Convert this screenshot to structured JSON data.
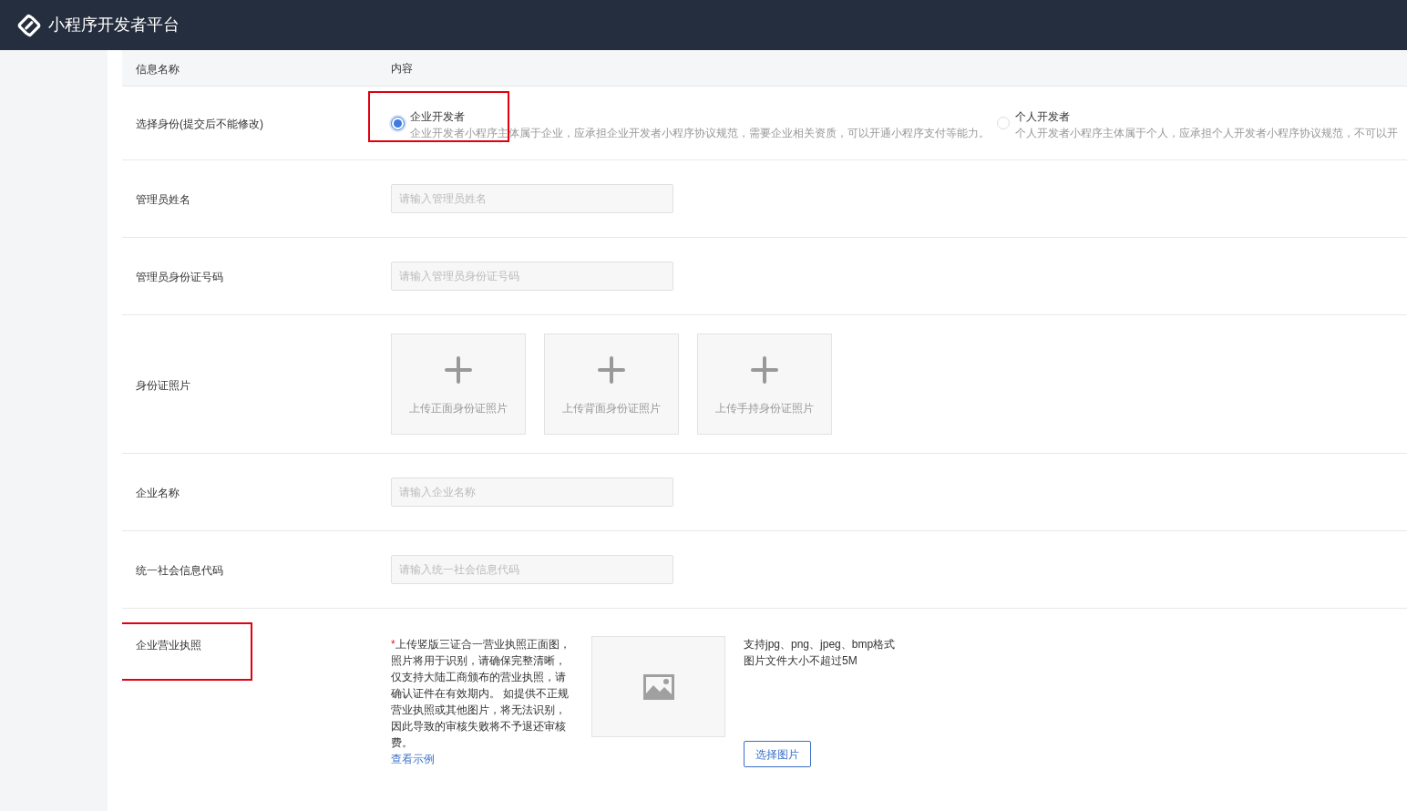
{
  "header": {
    "title": "小程序开发者平台"
  },
  "table": {
    "columns": [
      "信息名称",
      "内容"
    ],
    "rows": [
      {
        "kind": "radio",
        "label": "选择身份(提交后不能修改)",
        "highlighted": false,
        "options": [
          {
            "title": "企业开发者",
            "description": "企业开发者小程序主体属于企业，应承担企业开发者小程序协议规范，需要企业相关资质，可以开通小程序支付等能力。",
            "selected": true,
            "highlighted": true
          },
          {
            "title": "个人开发者",
            "description": "个人开发者小程序主体属于个人，应承担个人开发者小程序协议规范，不可以开",
            "selected": false,
            "highlighted": false
          }
        ]
      },
      {
        "kind": "input",
        "label": "管理员姓名",
        "placeholder": "请输入管理员姓名",
        "highlighted": false
      },
      {
        "kind": "input",
        "label": "管理员身份证号码",
        "placeholder": "请输入管理员身份证号码",
        "highlighted": false
      },
      {
        "kind": "upload",
        "label": "身份证照片",
        "highlighted": false,
        "slots": [
          {
            "caption": "上传正面身份证照片"
          },
          {
            "caption": "上传背面身份证照片"
          },
          {
            "caption": "上传手持身份证照片"
          }
        ]
      },
      {
        "kind": "input",
        "label": "企业名称",
        "placeholder": "请输入企业名称",
        "highlighted": false
      },
      {
        "kind": "input",
        "label": "统一社会信息代码",
        "placeholder": "请输入统一社会信息代码",
        "highlighted": false
      },
      {
        "kind": "license",
        "label": "企业营业执照",
        "highlighted": true,
        "required_mark": "*",
        "note": "上传竖版三证合一营业执照正面图，照片将用于识别，请确保完整清晰，仅支持大陆工商颁布的营业执照，请确认证件在有效期内。 如提供不正规营业执照或其他图片，将无法识别，因此导致的审核失败将不予退还审核费。",
        "example_link": "查看示例",
        "formats": "支持jpg、png、jpeg、bmp格式",
        "size_limit": "图片文件大小不超过5M",
        "button": "选择图片"
      }
    ]
  }
}
